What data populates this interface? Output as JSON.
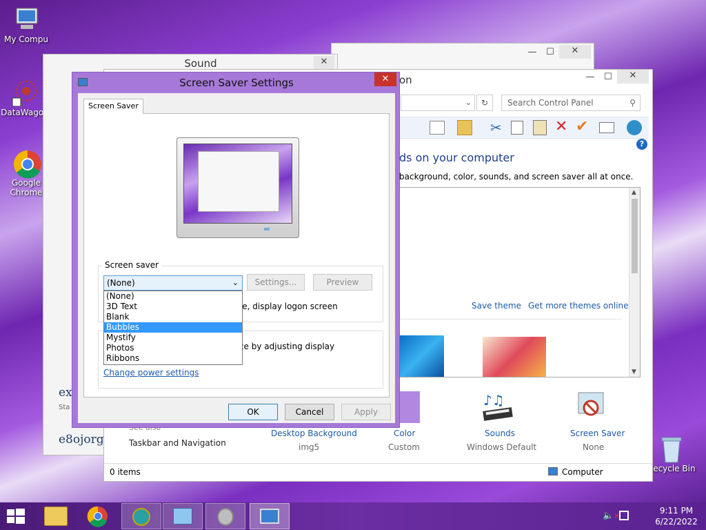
{
  "desktop": {
    "icons": [
      {
        "label": "My Compu"
      },
      {
        "label": "DataWagon"
      },
      {
        "label": "Google Chrome"
      },
      {
        "label": "Recycle Bin"
      }
    ]
  },
  "sound_window": {
    "title": "Sound",
    "text1": "ex",
    "text2": "Sta",
    "text3": "e8ojorg"
  },
  "control_panel": {
    "title_suffix": "on",
    "search_placeholder": "Search Control Panel",
    "heading": "ds on your computer",
    "subheading": "background, color, sounds, and screen saver all at once.",
    "save_theme": "Save theme",
    "get_more": "Get more themes online",
    "see_also": "See also",
    "taskbar_nav": "Taskbar and Navigation",
    "items": [
      {
        "label": "Desktop Background",
        "value": "img5"
      },
      {
        "label": "Color",
        "value": "Custom"
      },
      {
        "label": "Sounds",
        "value": "Windows Default"
      },
      {
        "label": "Screen Saver",
        "value": "None"
      }
    ],
    "status_items": "0 items",
    "status_computer": "Computer"
  },
  "dialog": {
    "title": "Screen Saver Settings",
    "tab": "Screen Saver",
    "group_label": "Screen saver",
    "selected": "(None)",
    "settings_btn": "Settings...",
    "preview_btn": "Preview",
    "resume_text": "ume, display logon screen",
    "power_text": "ance by adjusting display",
    "power_link": "Change power settings",
    "ok": "OK",
    "cancel": "Cancel",
    "apply": "Apply",
    "options": [
      "(None)",
      "3D Text",
      "Blank",
      "Bubbles",
      "Mystify",
      "Photos",
      "Ribbons"
    ],
    "highlighted": "Bubbles"
  },
  "taskbar": {
    "time": "9:11 PM",
    "date": "6/22/2022"
  },
  "colors": {
    "accent": "#a679d8",
    "highlight": "#3399ff",
    "link": "#1d5aa8"
  }
}
